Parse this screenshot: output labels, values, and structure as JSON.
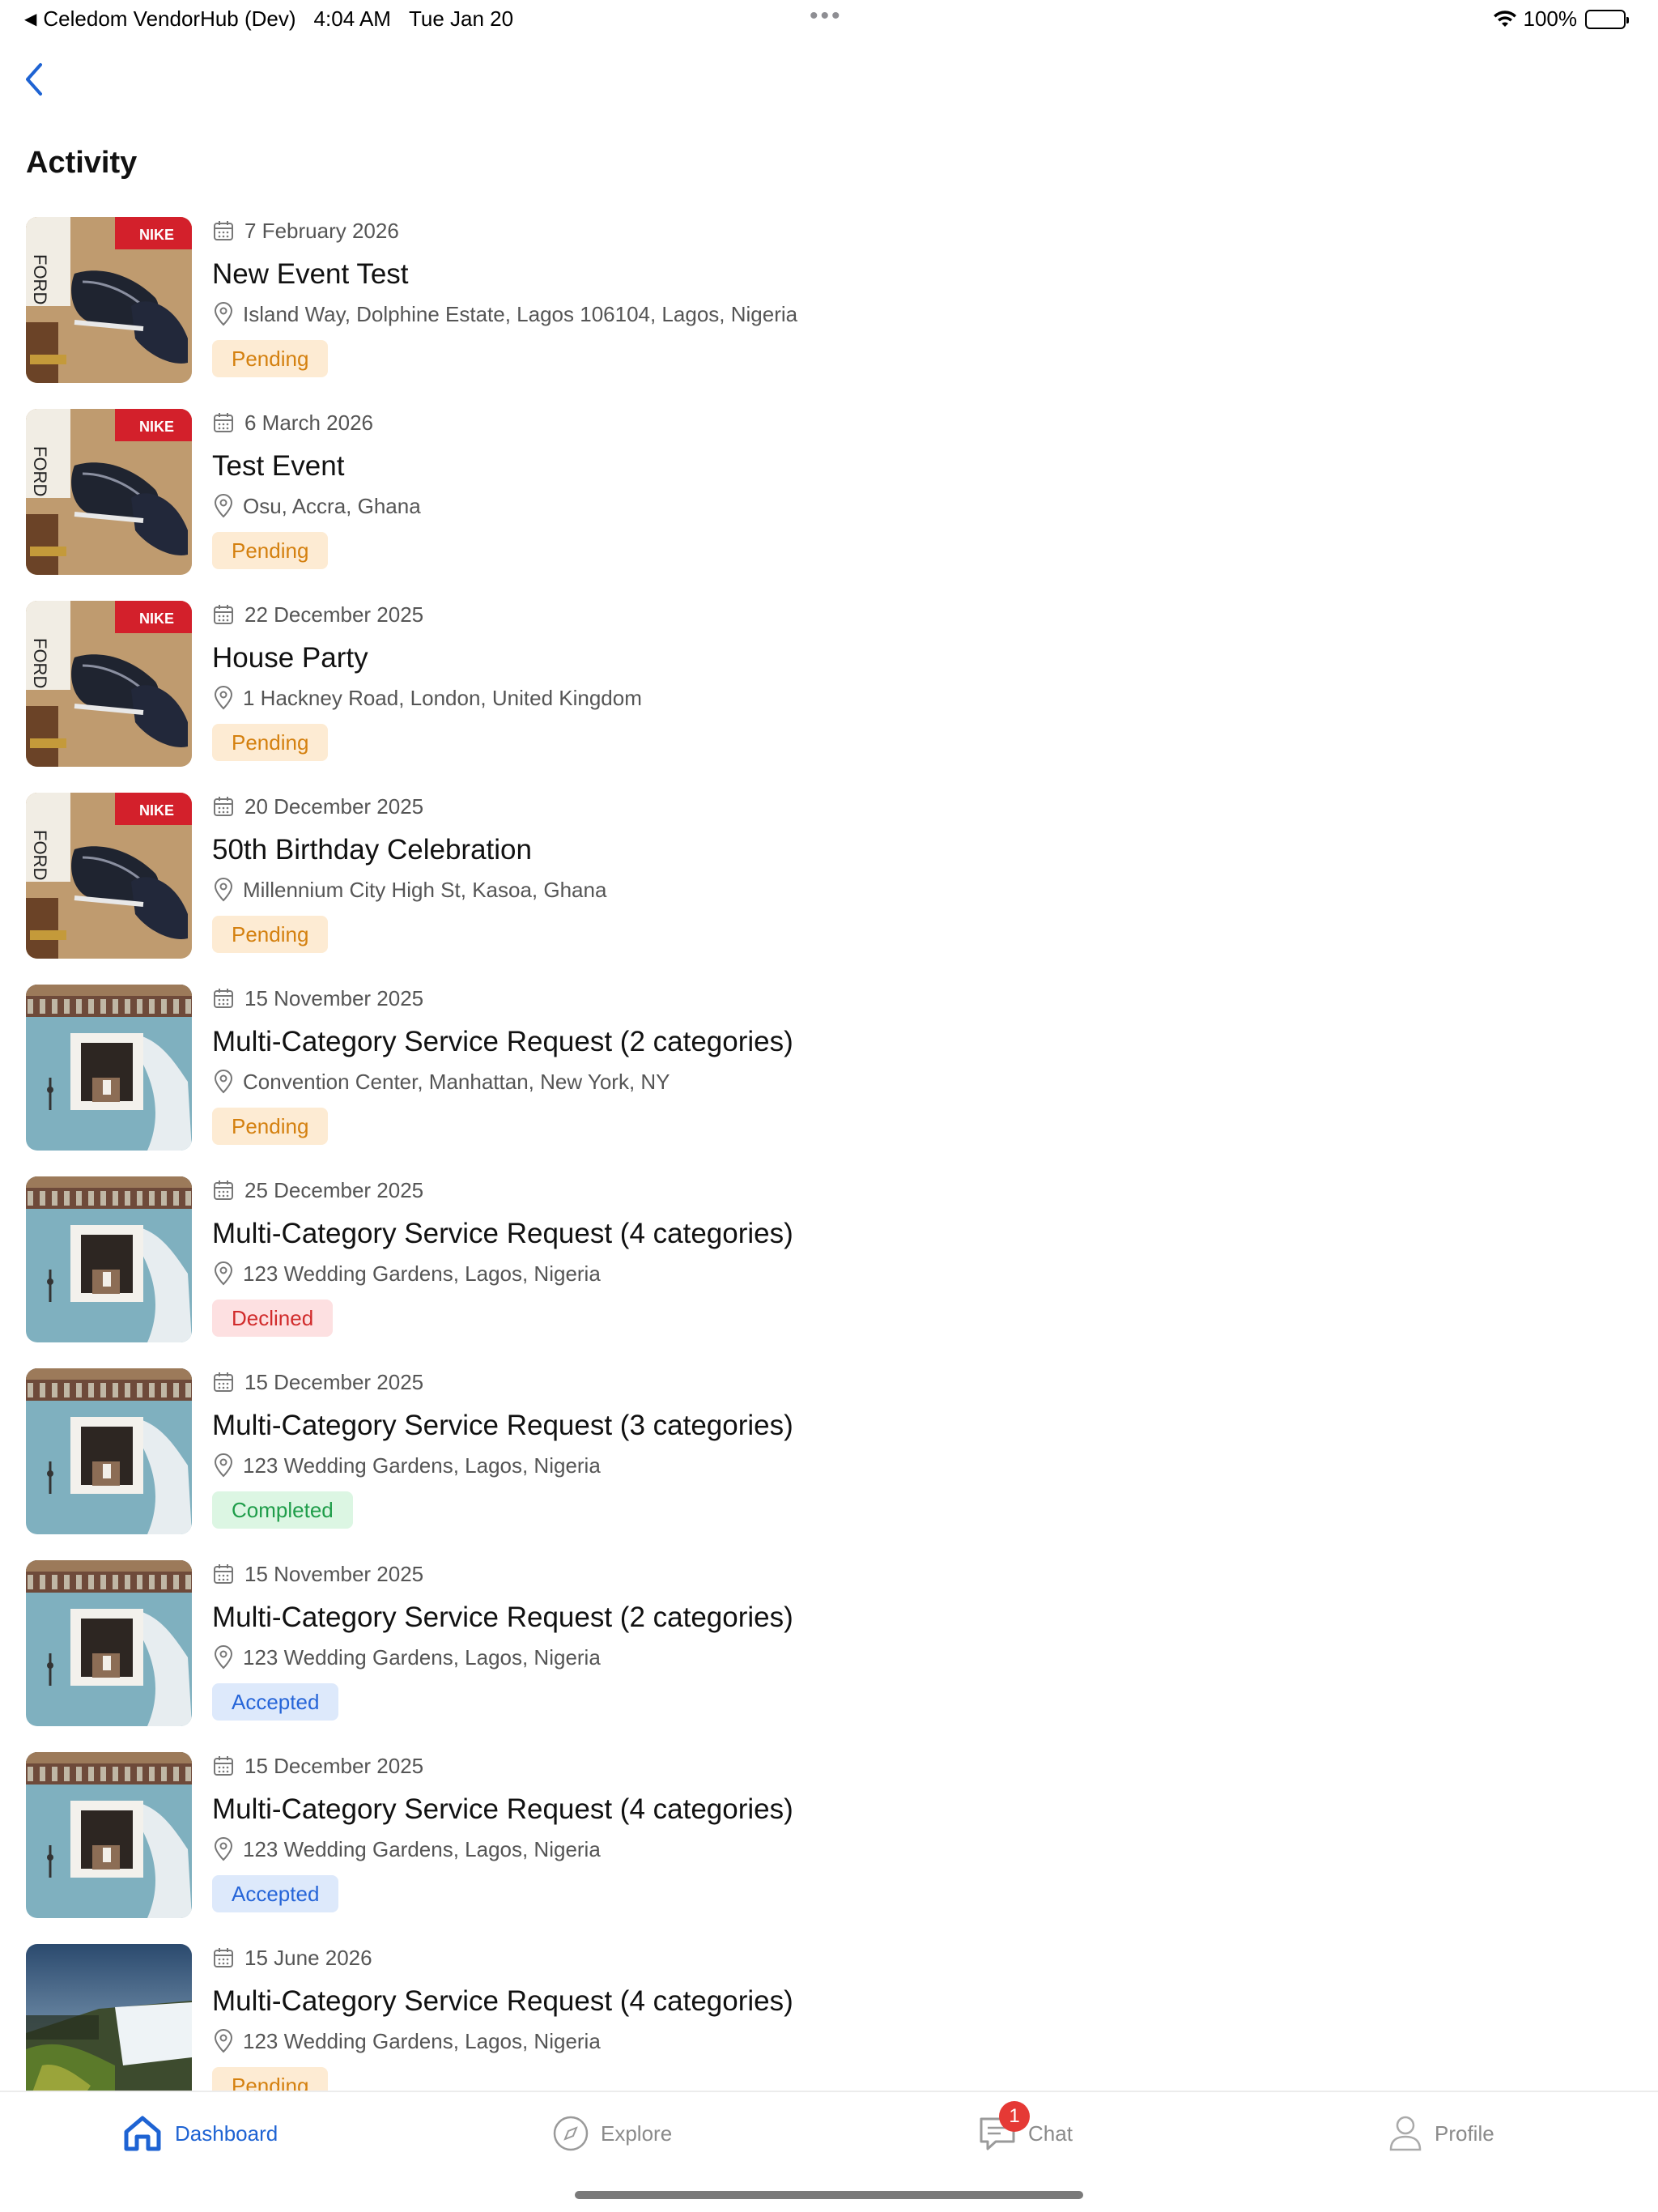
{
  "status_bar": {
    "back_app": "Celedom VendorHub (Dev)",
    "time": "4:04 AM",
    "date": "Tue Jan 20",
    "battery": "100%"
  },
  "header": {
    "title": "Activity"
  },
  "activities": [
    {
      "date": "7 February 2026",
      "title": "New Event Test",
      "location": "Island Way, Dolphine Estate, Lagos 106104, Lagos, Nigeria",
      "status": "Pending",
      "status_kind": "pending",
      "image": "sneakers"
    },
    {
      "date": "6 March 2026",
      "title": "Test Event",
      "location": "Osu, Accra, Ghana",
      "status": "Pending",
      "status_kind": "pending",
      "image": "sneakers"
    },
    {
      "date": "22 December 2025",
      "title": "House Party",
      "location": "1 Hackney Road, London, United Kingdom",
      "status": "Pending",
      "status_kind": "pending",
      "image": "sneakers"
    },
    {
      "date": "20 December 2025",
      "title": "50th Birthday Celebration",
      "location": "Millennium City High St, Kasoa, Ghana",
      "status": "Pending",
      "status_kind": "pending",
      "image": "sneakers"
    },
    {
      "date": "15 November 2025",
      "title": "Multi-Category Service Request (2 categories)",
      "location": "Convention Center, Manhattan, New York, NY",
      "status": "Pending",
      "status_kind": "pending",
      "image": "window"
    },
    {
      "date": "25 December 2025",
      "title": "Multi-Category Service Request (4 categories)",
      "location": "123 Wedding Gardens, Lagos, Nigeria",
      "status": "Declined",
      "status_kind": "declined",
      "image": "window"
    },
    {
      "date": "15 December 2025",
      "title": "Multi-Category Service Request (3 categories)",
      "location": "123 Wedding Gardens, Lagos, Nigeria",
      "status": "Completed",
      "status_kind": "completed",
      "image": "window"
    },
    {
      "date": "15 November 2025",
      "title": "Multi-Category Service Request (2 categories)",
      "location": "123 Wedding Gardens, Lagos, Nigeria",
      "status": "Accepted",
      "status_kind": "accepted",
      "image": "window"
    },
    {
      "date": "15 December 2025",
      "title": "Multi-Category Service Request (4 categories)",
      "location": "123 Wedding Gardens, Lagos, Nigeria",
      "status": "Accepted",
      "status_kind": "accepted",
      "image": "window"
    },
    {
      "date": "15 June 2026",
      "title": "Multi-Category Service Request (4 categories)",
      "location": "123 Wedding Gardens, Lagos, Nigeria",
      "status": "Pending",
      "status_kind": "pending",
      "image": "waterfall"
    }
  ],
  "tab_bar": {
    "dashboard": "Dashboard",
    "explore": "Explore",
    "chat": "Chat",
    "chat_badge": "1",
    "profile": "Profile"
  },
  "colors": {
    "accent": "#1e63d3",
    "pending_bg": "#fdebd3",
    "pending_fg": "#d4800f",
    "declined_bg": "#fde0e1",
    "declined_fg": "#d12b2b",
    "completed_bg": "#dcf6e3",
    "completed_fg": "#1f9d4a",
    "accepted_bg": "#dde9fb",
    "accepted_fg": "#2665d8"
  }
}
